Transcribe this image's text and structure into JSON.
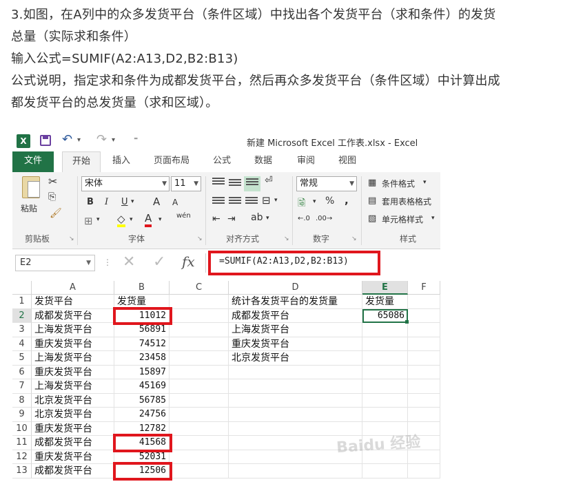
{
  "article": {
    "line1": "3.如图，在A列中的众多发货平台（条件区域）中找出各个发货平台（求和条件）的发货",
    "line2": "总量（实际求和条件）",
    "line3": "输入公式=SUMIF(A2:A13,D2,B2:B13)",
    "line4": "公式说明，指定求和条件为成都发货平台，然后再众多发货平台（条件区域）中计算出成",
    "line5": "都发货平台的总发货量（求和区域）。"
  },
  "excel": {
    "window_title": "新建 Microsoft Excel 工作表.xlsx - Excel",
    "logo": "X",
    "tabs": [
      "文件",
      "开始",
      "插入",
      "页面布局",
      "公式",
      "数据",
      "审阅",
      "视图"
    ],
    "clipboard": {
      "paste": "粘贴",
      "label": "剪贴板"
    },
    "font": {
      "name": "宋体",
      "size": "11",
      "bold": "B",
      "italic": "I",
      "underline": "U",
      "grow": "A",
      "shrink": "A",
      "label": "字体",
      "wen": "wén"
    },
    "alignment": {
      "label": "对齐方式"
    },
    "number": {
      "format": "常规",
      "percent": "%",
      "comma": ",",
      "label": "数字"
    },
    "styles": {
      "conditional": "条件格式",
      "table": "套用表格格式",
      "cell": "单元格样式",
      "label": "样式"
    },
    "name_box": "E2",
    "fx": "fx",
    "formula": "=SUMIF(A2:A13,D2,B2:B13)",
    "columns": [
      "A",
      "B",
      "C",
      "D",
      "E",
      "F"
    ],
    "rows": [
      {
        "n": "1",
        "a": "发货平台",
        "b": "发货量",
        "d": "统计各发货平台的发货量",
        "e": "发货量"
      },
      {
        "n": "2",
        "a": "成都发货平台",
        "b": "11012",
        "d": "成都发货平台",
        "e": "65086"
      },
      {
        "n": "3",
        "a": "上海发货平台",
        "b": "56891",
        "d": "上海发货平台",
        "e": ""
      },
      {
        "n": "4",
        "a": "重庆发货平台",
        "b": "74512",
        "d": "重庆发货平台",
        "e": ""
      },
      {
        "n": "5",
        "a": "上海发货平台",
        "b": "23458",
        "d": "北京发货平台",
        "e": ""
      },
      {
        "n": "6",
        "a": "重庆发货平台",
        "b": "15897",
        "d": "",
        "e": ""
      },
      {
        "n": "7",
        "a": "上海发货平台",
        "b": "45169",
        "d": "",
        "e": ""
      },
      {
        "n": "8",
        "a": "北京发货平台",
        "b": "56785",
        "d": "",
        "e": ""
      },
      {
        "n": "9",
        "a": "北京发货平台",
        "b": "24756",
        "d": "",
        "e": ""
      },
      {
        "n": "10",
        "a": "重庆发货平台",
        "b": "12782",
        "d": "",
        "e": ""
      },
      {
        "n": "11",
        "a": "成都发货平台",
        "b": "41568",
        "d": "",
        "e": ""
      },
      {
        "n": "12",
        "a": "重庆发货平台",
        "b": "52031",
        "d": "",
        "e": ""
      },
      {
        "n": "13",
        "a": "成都发货平台",
        "b": "12506",
        "d": "",
        "e": ""
      }
    ],
    "watermark": "Baidu 经验",
    "colors": {
      "excel_green": "#217346",
      "highlight_red": "#e0161d"
    }
  }
}
